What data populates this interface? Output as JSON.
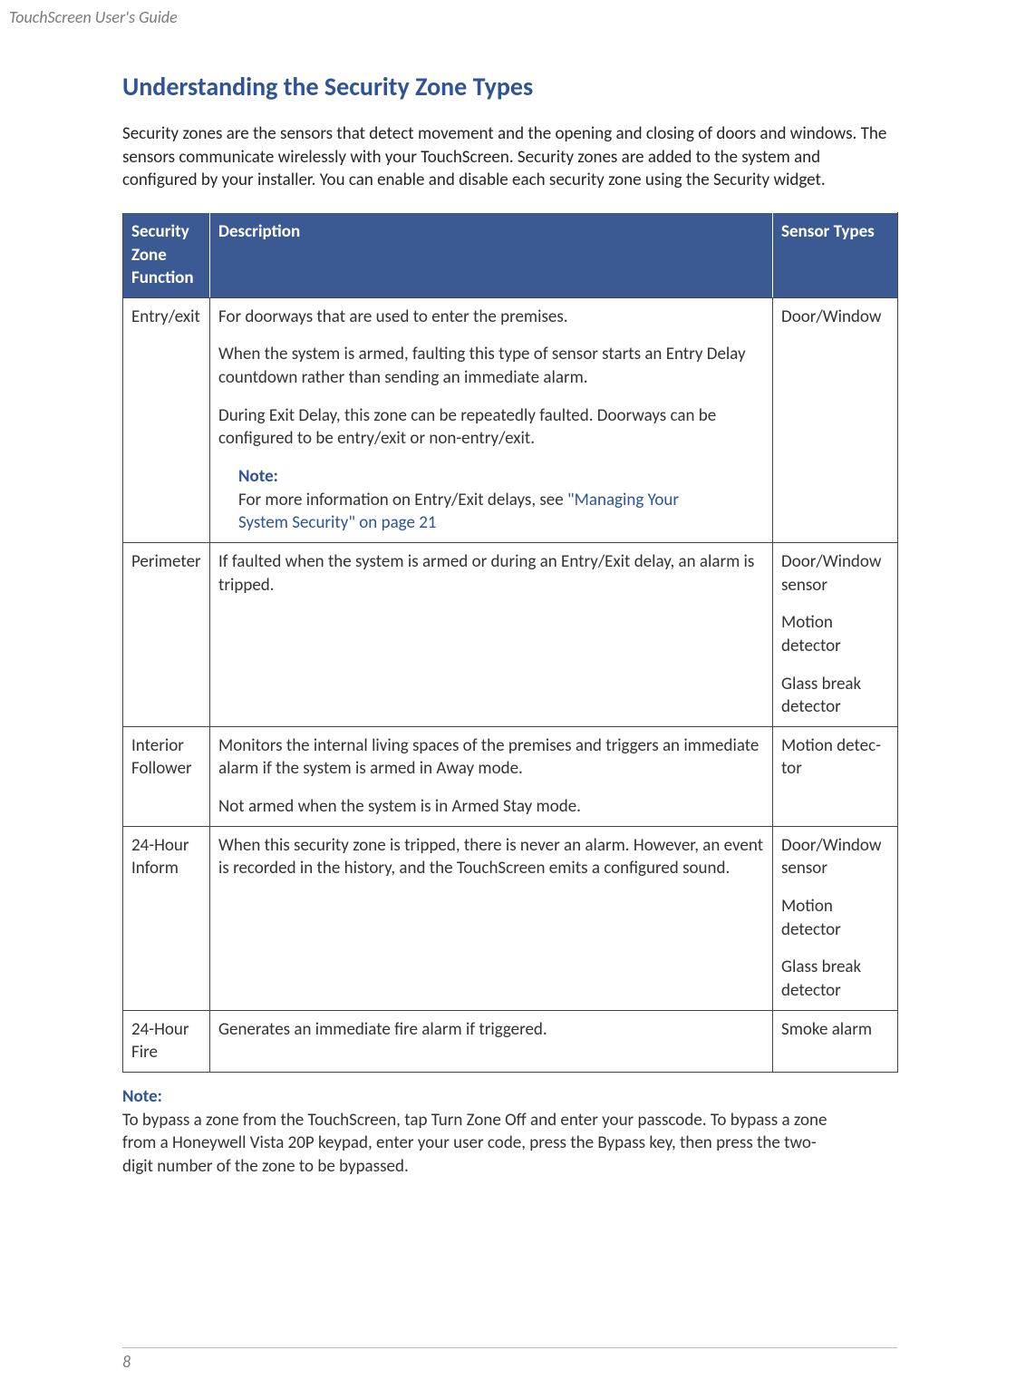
{
  "doc_header": "TouchScreen User's Guide",
  "page_number": "8",
  "section_title": "Understanding the Security Zone Types",
  "intro": "Security zones are the sensors that detect movement and the opening and closing of doors and windows. The sensors communicate wirelessly with your TouchScreen. Security zones are added to the system and configured by your installer. You can enable and disable each security zone using the Security widget.",
  "table": {
    "headers": {
      "c1": "Security Zone Function",
      "c2": "Description",
      "c3": "Sensor Types"
    },
    "rows": [
      {
        "fn": "Entry/exit",
        "desc_parts": [
          "For doorways that are used to enter the premises.",
          "When the system is armed, faulting this type of sensor starts an Entry Delay countdown rather than sending an immediate alarm.",
          "During Exit Delay, this zone can be repeatedly faulted. Doorways can be configured to be entry/exit or non-entry/exit."
        ],
        "note_label": "Note:",
        "note_text_pre": "For more information on Entry/Exit delays, see ",
        "note_link": "\"Managing Your System Security\" on page 21",
        "sensors": [
          "Door/Window"
        ]
      },
      {
        "fn": "Perimeter",
        "desc_parts": [
          "If faulted when the system is armed or during an Entry/Exit delay, an alarm is tripped."
        ],
        "sensors": [
          "Door/Window sensor",
          "Motion detector",
          "Glass break detector"
        ]
      },
      {
        "fn": "Interior Follower",
        "desc_parts": [
          "Monitors the internal living spaces of the premises and triggers an immediate alarm if the system is armed in Away mode.",
          "Not armed when the system is in Armed Stay mode."
        ],
        "sensors": [
          "Motion detec­tor"
        ]
      },
      {
        "fn": "24-Hour Inform",
        "desc_parts": [
          "When this security zone is tripped, there is never an alarm. However, an event is recorded in the history, and the TouchScreen emits a con­figured sound."
        ],
        "sensors": [
          "Door/Window sensor",
          "Motion detector",
          "Glass break detector"
        ]
      },
      {
        "fn": "24-Hour Fire",
        "desc_parts": [
          "Generates an immediate fire alarm if triggered."
        ],
        "sensors": [
          "Smoke alarm"
        ]
      }
    ]
  },
  "bottom_note": {
    "label": "Note:",
    "text": "To bypass a zone from the TouchScreen, tap Turn Zone Off and enter your passcode. To bypass a zone from a Honeywell Vista 20P keypad, enter your user code, press the Bypass key, then press the two-digit number of the zone to be bypassed."
  }
}
